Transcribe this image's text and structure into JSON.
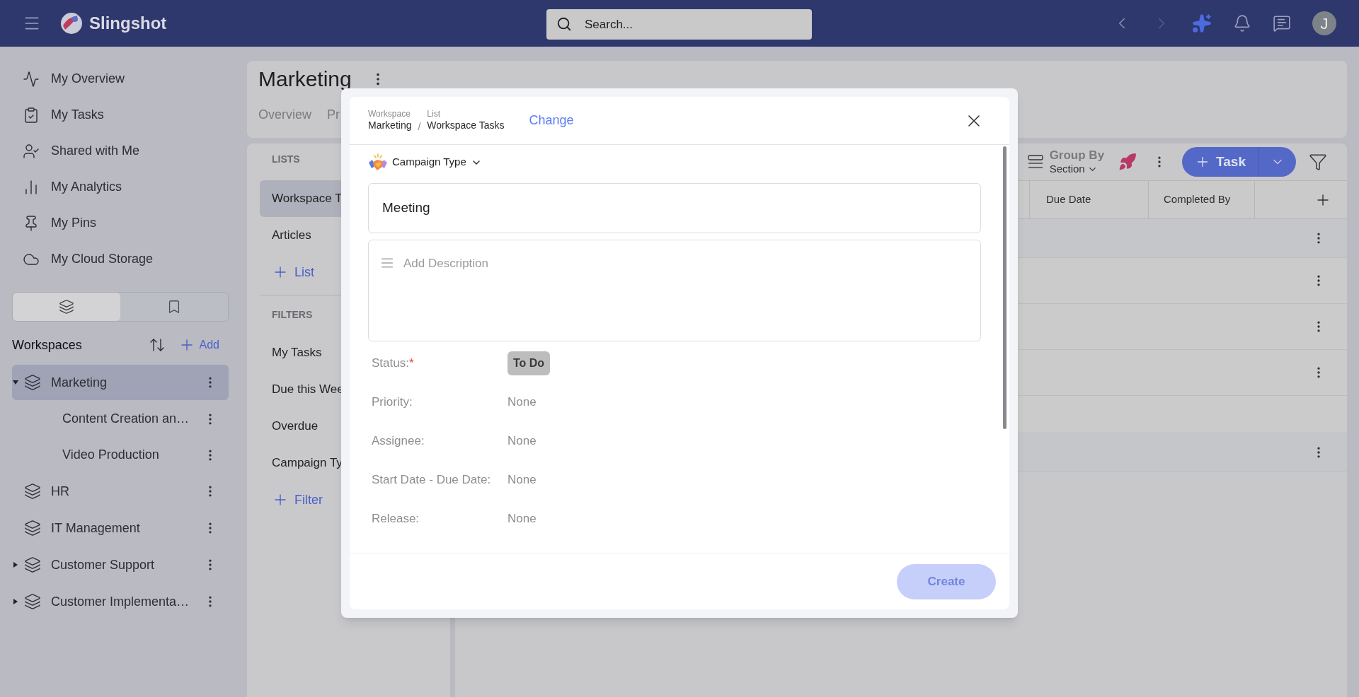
{
  "topbar": {
    "app_name": "Slingshot",
    "search": {
      "placeholder": "Search..."
    },
    "avatar": "J"
  },
  "sidebar": {
    "nav": [
      {
        "label": "My Overview"
      },
      {
        "label": "My Tasks"
      },
      {
        "label": "Shared with Me"
      },
      {
        "label": "My Analytics"
      },
      {
        "label": "My Pins"
      },
      {
        "label": "My Cloud Storage"
      }
    ],
    "view_toggle": [
      {
        "selected": true
      },
      {
        "selected": false
      }
    ],
    "workspaces": {
      "title": "Workspaces",
      "add": "Add",
      "items": [
        {
          "label": "Marketing",
          "selected": true,
          "has_children": true,
          "expanded": true,
          "children": [
            {
              "label": "Content Creation an…",
              "selected": false
            },
            {
              "label": "Video Production",
              "selected": false
            }
          ]
        },
        {
          "label": "HR",
          "selected": false,
          "has_children": false,
          "expanded": false
        },
        {
          "label": "IT Management",
          "selected": false,
          "has_children": false,
          "expanded": false
        },
        {
          "label": "Customer Support",
          "selected": false,
          "has_children": true,
          "expanded": false
        },
        {
          "label": "Customer Implementa…",
          "selected": false,
          "has_children": true,
          "expanded": false
        }
      ]
    }
  },
  "header": {
    "title": "Marketing",
    "tabs": [
      {
        "label": "Overview",
        "selected": false
      },
      {
        "label": "Pr",
        "selected": false
      }
    ]
  },
  "lists_panel": {
    "lists_heading": "LISTS",
    "lists": [
      {
        "label": "Workspace T",
        "selected": true
      },
      {
        "label": "Articles",
        "selected": false
      }
    ],
    "add_list": "List",
    "filters_heading": "FILTERS",
    "filters": [
      {
        "label": "My Tasks",
        "selected": false
      },
      {
        "label": "Due this Wee",
        "selected": false
      },
      {
        "label": "Overdue",
        "selected": false
      },
      {
        "label": "Campaign Ty",
        "selected": false
      }
    ],
    "add_filter": "Filter"
  },
  "table": {
    "group_by": {
      "label": "Group By",
      "value": "Section"
    },
    "new_button": "Task",
    "columns": [
      "Due Date",
      "Completed By"
    ],
    "rows": [
      {
        "kind": "group"
      },
      {
        "kind": "task"
      },
      {
        "kind": "task"
      },
      {
        "kind": "task"
      },
      {
        "kind": "blank"
      },
      {
        "kind": "group"
      }
    ]
  },
  "modal": {
    "separator": "/",
    "required_mark": "*",
    "breadcrumb": [
      {
        "caption": "Workspace",
        "value": "Marketing"
      },
      {
        "caption": "List",
        "value": "Workspace Tasks"
      }
    ],
    "change_link": "Change",
    "type": "Campaign Type",
    "title_value": "Meeting",
    "description": {
      "placeholder": "Add Description"
    },
    "fields": [
      {
        "label": "Status:",
        "required": true,
        "kind": "status",
        "value": "To Do"
      },
      {
        "label": "Priority:",
        "required": false,
        "kind": "text",
        "value": "None"
      },
      {
        "label": "Assignee:",
        "required": false,
        "kind": "text",
        "value": "None"
      },
      {
        "label": "Start Date - Due Date:",
        "required": false,
        "kind": "text",
        "value": "None"
      },
      {
        "label": "Release:",
        "required": false,
        "kind": "text",
        "value": "None"
      }
    ],
    "create_button": {
      "label": "Create",
      "disabled": true
    }
  }
}
